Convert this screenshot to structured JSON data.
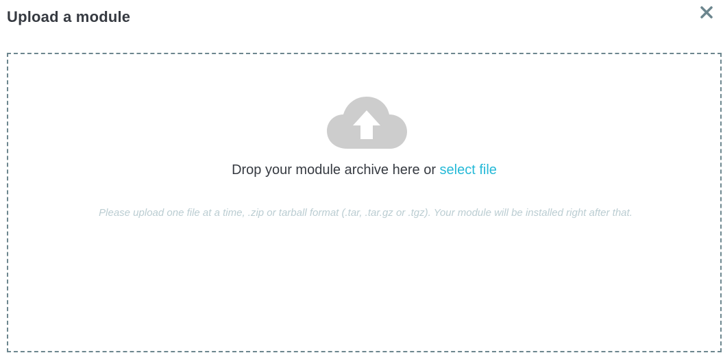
{
  "modal": {
    "title": "Upload a module",
    "close_icon": "close-icon"
  },
  "dropzone": {
    "icon": "cloud-upload-icon",
    "drop_text": "Drop your module archive here or",
    "select_link": "select file",
    "help_text": "Please upload one file at a time, .zip or tarball format (.tar, .tar.gz or .tgz). Your module will be installed right after that."
  },
  "colors": {
    "title": "#363a41",
    "link": "#25b9d7",
    "dashed_border": "#6c868e",
    "icon": "#cdcdcd",
    "help_text": "#bbcdd2"
  }
}
